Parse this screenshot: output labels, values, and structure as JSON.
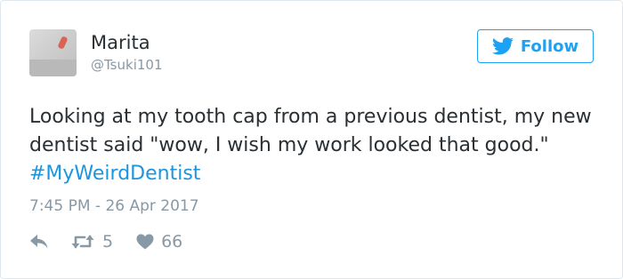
{
  "tweet": {
    "author": {
      "display_name": "Marita",
      "handle": "@Tsuki101"
    },
    "follow_label": "Follow",
    "text": "Looking at my tooth cap from a previous dentist, my new dentist said \"wow, I wish my work looked that good.\"",
    "hashtag": "#MyWeirdDentist",
    "timestamp": "7:45 PM - 26 Apr 2017",
    "retweet_count": "5",
    "like_count": "66"
  },
  "icons": {
    "follow": "twitter-bird-icon",
    "reply": "reply-arrow-icon",
    "retweet": "retweet-icon",
    "like": "heart-icon"
  },
  "colors": {
    "accent": "#1da1f2",
    "text": "#292f33",
    "muted": "#8899a6",
    "border": "#e1e8ed"
  }
}
